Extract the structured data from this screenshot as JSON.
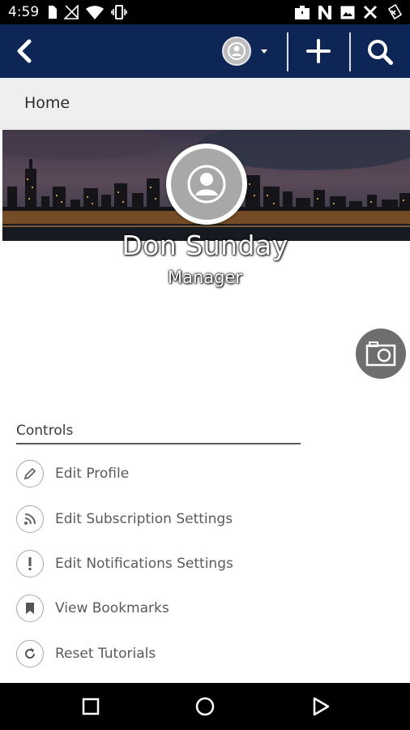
{
  "status_bar": {
    "time": "4:59",
    "left_icons": [
      "sd-card-icon",
      "no-signal-icon",
      "wifi-icon",
      "vibrate-icon"
    ],
    "right_icons": [
      "briefcase-icon",
      "n-app-icon",
      "image-icon",
      "tools-icon",
      "battery-icon"
    ]
  },
  "app_bar": {
    "background": "#0d2656",
    "icons": [
      "back-chevron-icon",
      "account-avatar-icon",
      "dropdown-caret-icon",
      "plus-icon",
      "search-icon"
    ]
  },
  "breadcrumb": {
    "label": "Home"
  },
  "profile": {
    "name": "Don Sunday",
    "role": "Manager",
    "banner_icon": "city-skyline-image",
    "camera_icon": "camera-icon"
  },
  "controls": {
    "title": "Controls",
    "items": [
      {
        "label": "Edit Profile",
        "icon": "pencil-icon"
      },
      {
        "label": "Edit Subscription Settings",
        "icon": "rss-icon"
      },
      {
        "label": "Edit Notifications Settings",
        "icon": "exclamation-icon"
      },
      {
        "label": "View Bookmarks",
        "icon": "bookmark-icon"
      },
      {
        "label": "Reset Tutorials",
        "icon": "refresh-icon"
      }
    ]
  },
  "nav_bar": {
    "icons": [
      "recents-square-icon",
      "home-circle-icon",
      "back-triangle-icon"
    ]
  }
}
